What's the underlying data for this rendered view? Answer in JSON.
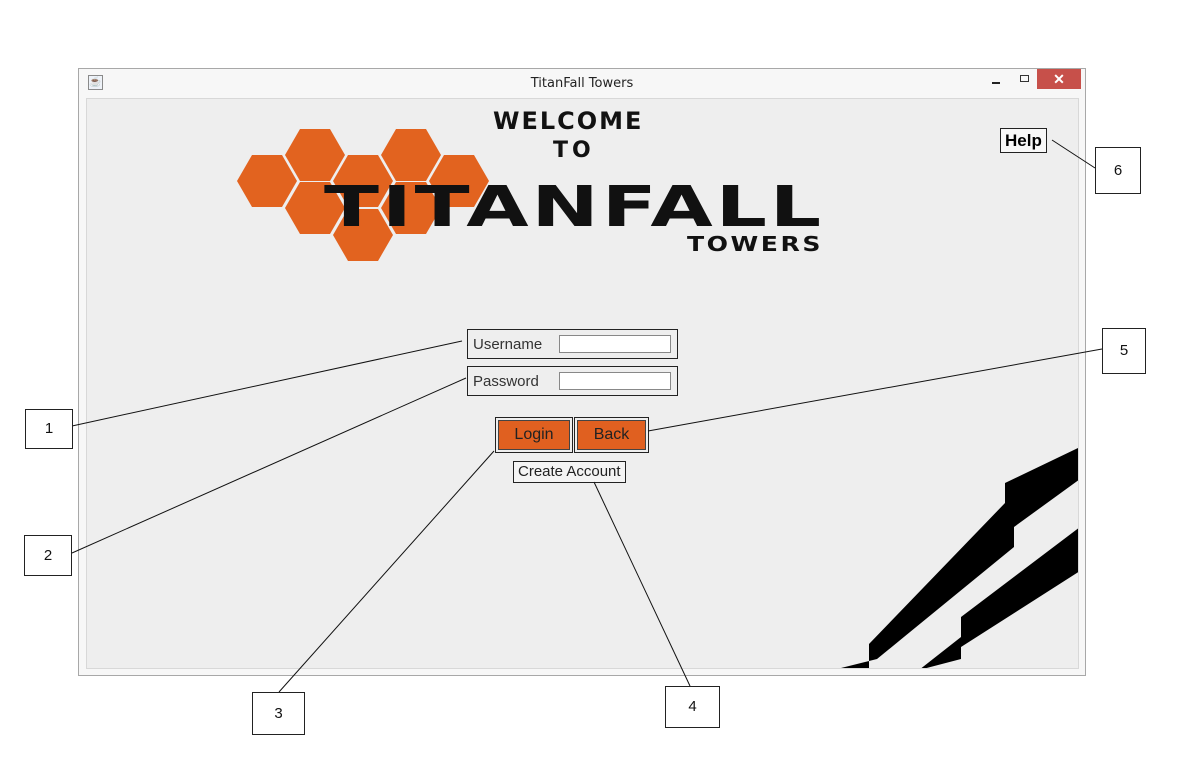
{
  "window": {
    "title": "TitanFall Towers",
    "close_glyph": "✕",
    "icon": "java-cup-icon"
  },
  "logo": {
    "line1": "WELCOME",
    "line2": "TO",
    "brand": "TITANFALL",
    "subbrand": "TOWERS",
    "hex_color": "#e2631f",
    "text_color": "#111111"
  },
  "help": {
    "label": "Help"
  },
  "login_form": {
    "username_label": "Username",
    "username_value": "",
    "password_label": "Password",
    "password_value": ""
  },
  "buttons": {
    "login": "Login",
    "back": "Back",
    "create_account": "Create Account",
    "accent": "#e06020"
  },
  "callouts": [
    "1",
    "2",
    "3",
    "4",
    "5",
    "6"
  ]
}
